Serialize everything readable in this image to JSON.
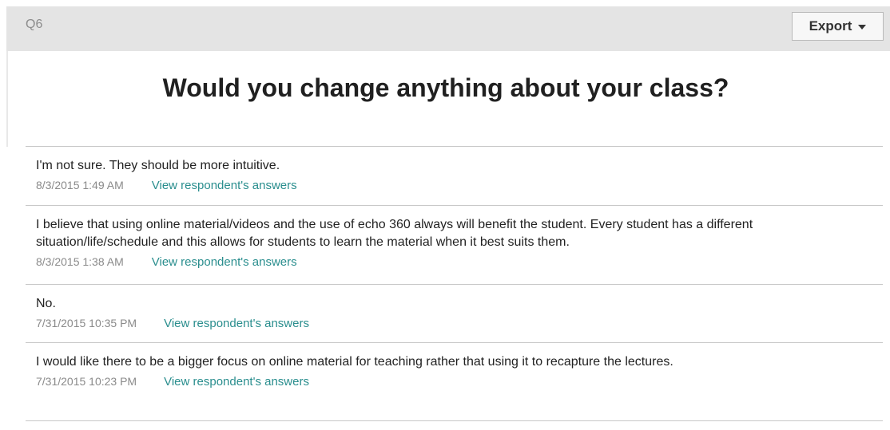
{
  "header": {
    "question_id": "Q6",
    "export_label": "Export",
    "export_icon": "caret-down-icon"
  },
  "question": {
    "title": "Would you change anything about your class?"
  },
  "responses": [
    {
      "text": "I'm not sure. They should be more intuitive.",
      "date": "8/3/2015 1:49 AM",
      "link": "View respondent's answers"
    },
    {
      "text": "I believe that using online material/videos and the use of echo 360 always will benefit the student. Every student has a different situation/life/schedule and this allows for students to learn the material when it best suits them.",
      "date": "8/3/2015 1:38 AM",
      "link": "View respondent's answers"
    },
    {
      "text": "No.",
      "date": "7/31/2015 10:35 PM",
      "link": "View respondent's answers"
    },
    {
      "text": "I would like there to be a bigger focus on online material for teaching rather that using it to recapture the lectures.",
      "date": "7/31/2015 10:23 PM",
      "link": "View respondent's answers"
    }
  ],
  "colors": {
    "header_bg": "#e4e4e4",
    "link": "#2a8e8e",
    "date": "#8a8a8a",
    "divider": "#c8c8c8"
  }
}
